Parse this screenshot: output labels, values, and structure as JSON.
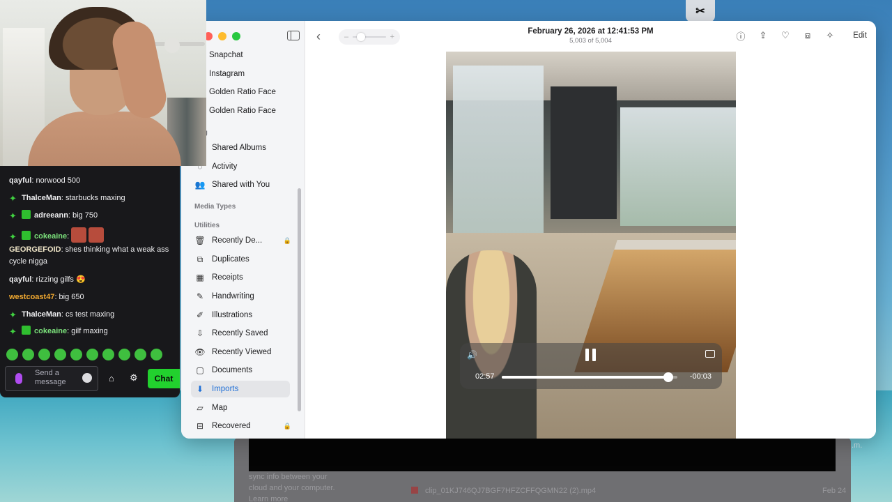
{
  "desktop": {
    "text_lines": [
      "sync info between your",
      "cloud and your computer.",
      "Learn more"
    ],
    "file_name": "clip_01KJ746QJ7BGF7HFZCFFQGMN22 (2).mp4",
    "file_date": "Feb 24",
    "right_text": ".m."
  },
  "photos": {
    "title": "February 26, 2026 at 12:41:53 PM",
    "subtitle": "5,003 of 5,004",
    "edit_label": "Edit",
    "sidebar": {
      "items": [
        {
          "label": "Snapchat",
          "thumb": "#b07a55"
        },
        {
          "label": "Instagram",
          "thumb": "#8a6a5a"
        },
        {
          "label": "Golden Ratio Face",
          "thumb": "#8a3a3a"
        },
        {
          "label": "Golden Ratio Face",
          "thumb": "none"
        }
      ],
      "sharing_head": "ring",
      "sharing": [
        {
          "label": "Shared Albums",
          "icon": "shared-albums-icon"
        },
        {
          "label": "Activity",
          "icon": "activity-icon"
        },
        {
          "label": "Shared with You",
          "icon": "shared-with-you-icon"
        }
      ],
      "media_types_head": "Media Types",
      "utilities_head": "Utilities",
      "utilities": [
        {
          "label": "Recently De...",
          "icon": "trash-icon",
          "locked": true
        },
        {
          "label": "Duplicates",
          "icon": "duplicates-icon"
        },
        {
          "label": "Receipts",
          "icon": "receipts-icon"
        },
        {
          "label": "Handwriting",
          "icon": "handwriting-icon"
        },
        {
          "label": "Illustrations",
          "icon": "illustrations-icon"
        },
        {
          "label": "Recently Saved",
          "icon": "recently-saved-icon"
        },
        {
          "label": "Recently Viewed",
          "icon": "eye-icon"
        },
        {
          "label": "Documents",
          "icon": "documents-icon"
        },
        {
          "label": "Imports",
          "icon": "imports-icon",
          "active": true
        },
        {
          "label": "Map",
          "icon": "map-icon"
        },
        {
          "label": "Recovered",
          "icon": "recovered-icon",
          "locked": true
        }
      ]
    },
    "video": {
      "elapsed": "02:57",
      "remaining": "-00:03",
      "progress": 0.95
    }
  },
  "chat": {
    "messages": [
      {
        "user": "qayful",
        "color": "#efeff1",
        "text": " norwood 500",
        "badges": []
      },
      {
        "user": "ThalceMan",
        "color": "#efeff1",
        "text": " starbucks maxing",
        "badges": [
          "star"
        ]
      },
      {
        "user": "adreeann",
        "color": "#efeff1",
        "text": " big 750",
        "badges": [
          "star",
          "sq"
        ]
      },
      {
        "user": "cokeaine",
        "color": "#7be07b",
        "text": "",
        "badges": [
          "star",
          "sq"
        ],
        "emotes": 2
      },
      {
        "user": "GEORGEFOID",
        "color": "#f0e6c8",
        "text": " shes thinking what a weak ass cycle nigga",
        "badges": []
      },
      {
        "user": "qayful",
        "color": "#efeff1",
        "text": " rizzing gilfs 😍",
        "badges": []
      },
      {
        "user": "westcoast47",
        "color": "#f0a830",
        "text": " big 650",
        "badges": []
      },
      {
        "user": "ThalceMan",
        "color": "#efeff1",
        "text": " cs test maxing",
        "badges": [
          "star"
        ]
      },
      {
        "user": "cokeaine",
        "color": "#7be07b",
        "text": " gilf maxing",
        "badges": [
          "star",
          "sq"
        ]
      }
    ],
    "input_placeholder": "Send a message",
    "chat_button": "Chat"
  }
}
